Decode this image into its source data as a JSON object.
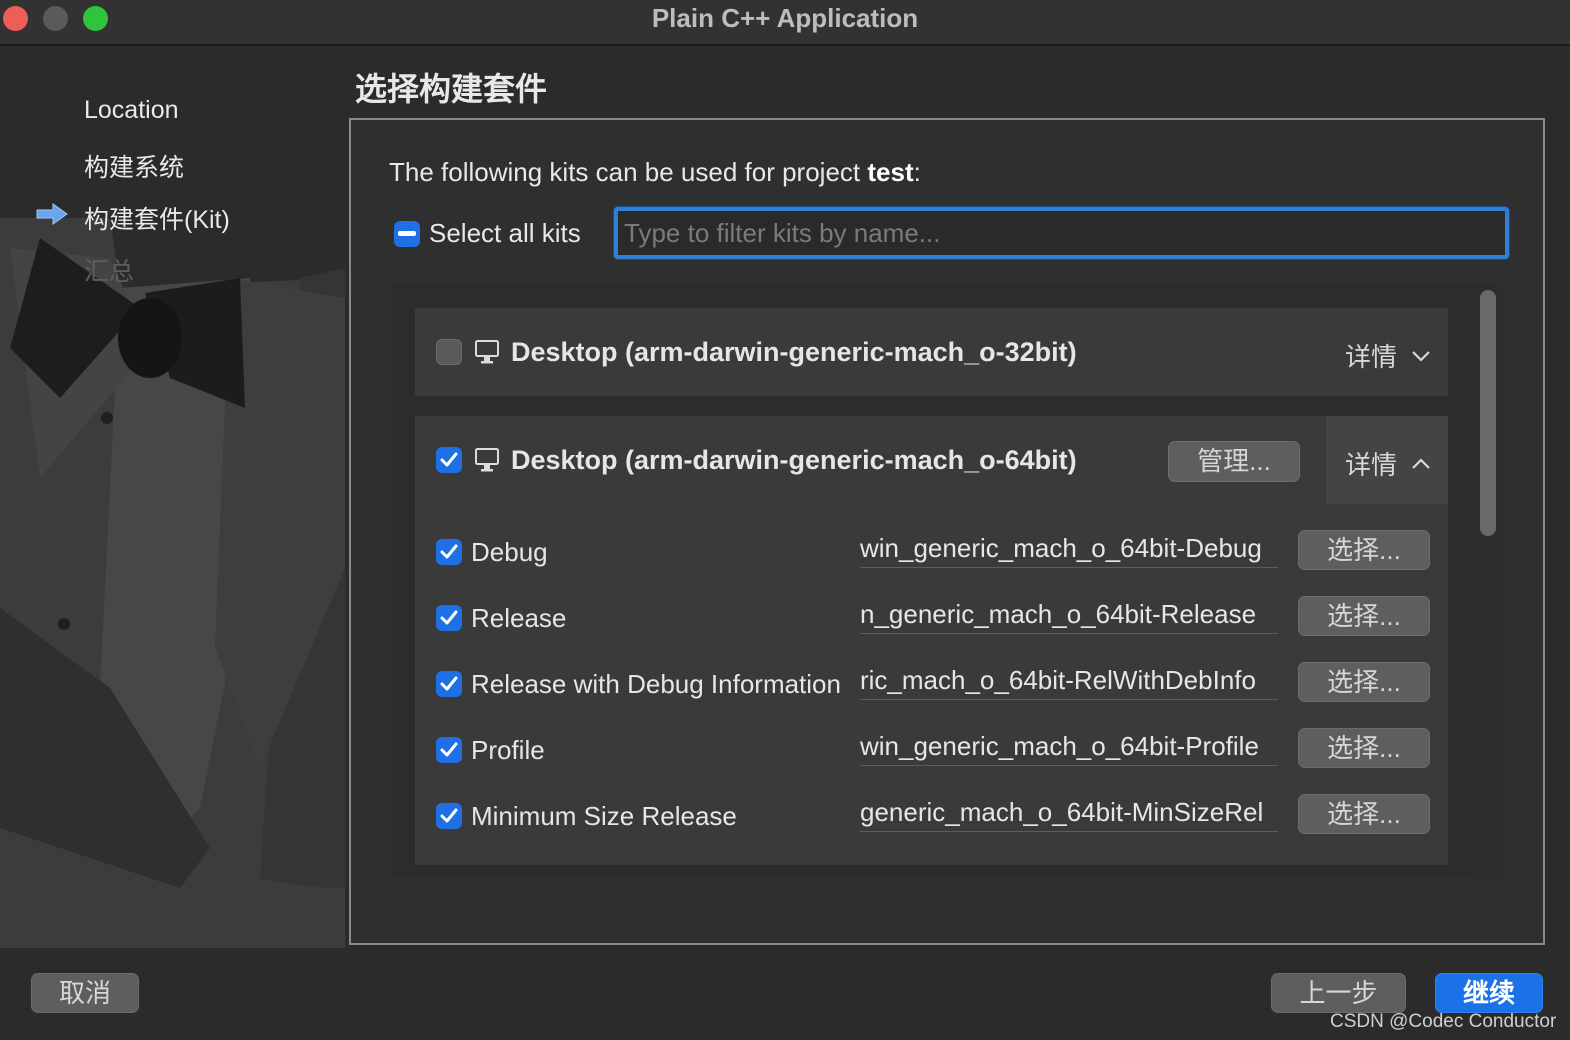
{
  "window": {
    "title": "Plain C++ Application"
  },
  "sidebar": {
    "steps": [
      {
        "label": "Location",
        "state": "done"
      },
      {
        "label": "构建系统",
        "state": "done"
      },
      {
        "label": "构建套件(Kit)",
        "state": "current"
      },
      {
        "label": "汇总",
        "state": "pending"
      }
    ]
  },
  "page": {
    "title": "选择构建套件",
    "intro_prefix": "The following kits can be used for project ",
    "project_name": "test",
    "intro_suffix": ":"
  },
  "select_all": {
    "label": "Select all kits",
    "state": "mixed"
  },
  "filter": {
    "placeholder": "Type to filter kits by name...",
    "value": ""
  },
  "kits": [
    {
      "name": "Desktop (arm-darwin-generic-mach_o-32bit)",
      "checked": false,
      "details_label": "详情",
      "expanded": false
    },
    {
      "name": "Desktop (arm-darwin-generic-mach_o-64bit)",
      "checked": true,
      "manage_label": "管理...",
      "details_label": "详情",
      "expanded": true,
      "configs": [
        {
          "label": "Debug",
          "checked": true,
          "path_visible": "win_generic_mach_o_64bit-Debug",
          "choose_label": "选择..."
        },
        {
          "label": "Release",
          "checked": true,
          "path_visible": "n_generic_mach_o_64bit-Release",
          "choose_label": "选择..."
        },
        {
          "label": "Release with Debug Information",
          "checked": true,
          "path_visible": "ric_mach_o_64bit-RelWithDebInfo",
          "choose_label": "选择..."
        },
        {
          "label": "Profile",
          "checked": true,
          "path_visible": "win_generic_mach_o_64bit-Profile",
          "choose_label": "选择..."
        },
        {
          "label": "Minimum Size Release",
          "checked": true,
          "path_visible": "generic_mach_o_64bit-MinSizeRel",
          "choose_label": "选择..."
        }
      ]
    }
  ],
  "footer": {
    "cancel_label": "取消",
    "back_label": "上一步",
    "next_label": "继续"
  },
  "watermark": "CSDN @Codec Conductor",
  "colors": {
    "accent": "#1f6fe5",
    "window_bg": "#2b2b2b",
    "card_bg": "#3a3a3a",
    "focus_ring": "#2f7fd6"
  }
}
